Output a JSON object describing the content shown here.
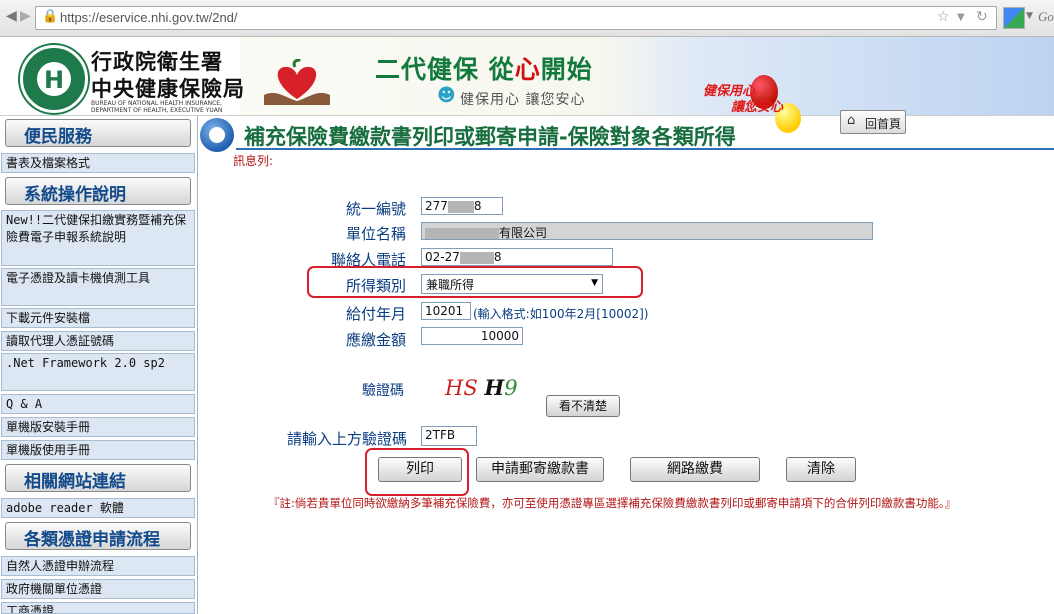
{
  "browser": {
    "url": "https://eservice.nhi.gov.tw/2nd/",
    "search_hint": "Go"
  },
  "banner": {
    "org_line1": "行政院衛生署",
    "org_line2": "中央健康保險局",
    "org_en_line1": "BUREAU OF NATIONAL HEALTH INSURANCE,",
    "org_en_line2": "DEPARTMENT OF HEALTH, EXECUTIVE YUAN",
    "slogan_a": "二代健保 從",
    "slogan_b": "心",
    "slogan_c": "開始",
    "sub_slogan": "健保用心  讓您安心",
    "slogan2_line1": "健保用心",
    "slogan2_line2": "讓您安心",
    "home_label": "回首頁"
  },
  "sidebar": {
    "sections": [
      {
        "title": "便民服務"
      },
      {
        "title": "系統操作說明"
      },
      {
        "title": "相關網站連結"
      },
      {
        "title": "各類憑證申請流程"
      }
    ],
    "items": [
      {
        "label": "書表及檔案格式"
      },
      {
        "label": "New!!二代健保扣繳實務暨補充保險費電子申報系統說明"
      },
      {
        "label": "電子憑證及讀卡機偵測工具"
      },
      {
        "label": "下載元件安裝檔"
      },
      {
        "label": "讀取代理人憑証號碼"
      },
      {
        "label": ".Net Framework 2.0 sp2"
      },
      {
        "label": "Q & A"
      },
      {
        "label": "單機版安裝手冊"
      },
      {
        "label": "單機版使用手冊"
      },
      {
        "label": "adobe reader 軟體"
      },
      {
        "label": "自然人憑證申辦流程"
      },
      {
        "label": "政府機關單位憑證"
      },
      {
        "label": "工商憑證"
      }
    ]
  },
  "main": {
    "title": "補充保險費繳款書列印或郵寄申請-保險對象各類所得",
    "message_label": "訊息列:",
    "form": {
      "tax_id_label": "統一編號",
      "tax_id_prefix": "277",
      "tax_id_suffix": "8",
      "company_label": "單位名稱",
      "company_suffix": "有限公司",
      "phone_label": "聯絡人電話",
      "phone_prefix": "02-27",
      "phone_suffix": "8",
      "income_type_label": "所得類別",
      "income_type_value": "兼職所得",
      "pay_month_label": "給付年月",
      "pay_month_value": "10201",
      "pay_month_hint": "(輸入格式:如100年2月[10002])",
      "amount_label": "應繳金額",
      "amount_value": "10000",
      "captcha_label": "驗證碼",
      "captcha_c1": "HS",
      "captcha_c2": "H",
      "captcha_c3": "9",
      "captcha_refresh": "看不清楚",
      "captcha_input_label": "請輸入上方驗證碼",
      "captcha_input_value": "2TFB"
    },
    "buttons": {
      "print": "列印",
      "mail": "申請郵寄繳款書",
      "online_pay": "網路繳費",
      "clear": "清除"
    },
    "note": "『註:倘若貴單位同時欲繳納多筆補充保險費，亦可至使用憑證專區選擇補充保險費繳款書列印或郵寄申請項下的合併列印繳款書功能。』"
  }
}
